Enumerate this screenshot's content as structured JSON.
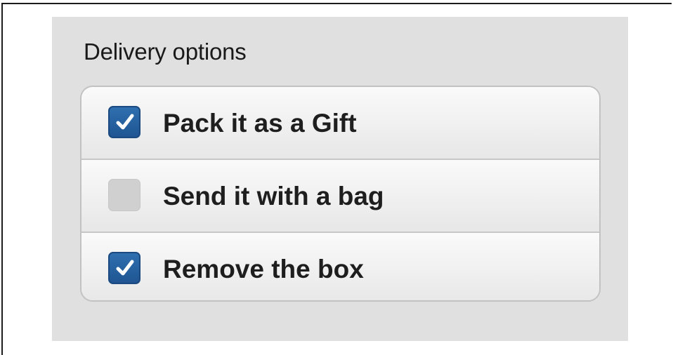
{
  "delivery": {
    "title": "Delivery options",
    "options": [
      {
        "label": "Pack it as a Gift",
        "checked": true
      },
      {
        "label": "Send it with a bag",
        "checked": false
      },
      {
        "label": "Remove the box",
        "checked": true
      }
    ]
  },
  "colors": {
    "checked_fill": "#2a64a4",
    "unchecked_fill": "#d0d0d0",
    "panel_background": "#e0e0e0"
  },
  "icons": {
    "checkmark": "check-icon"
  }
}
